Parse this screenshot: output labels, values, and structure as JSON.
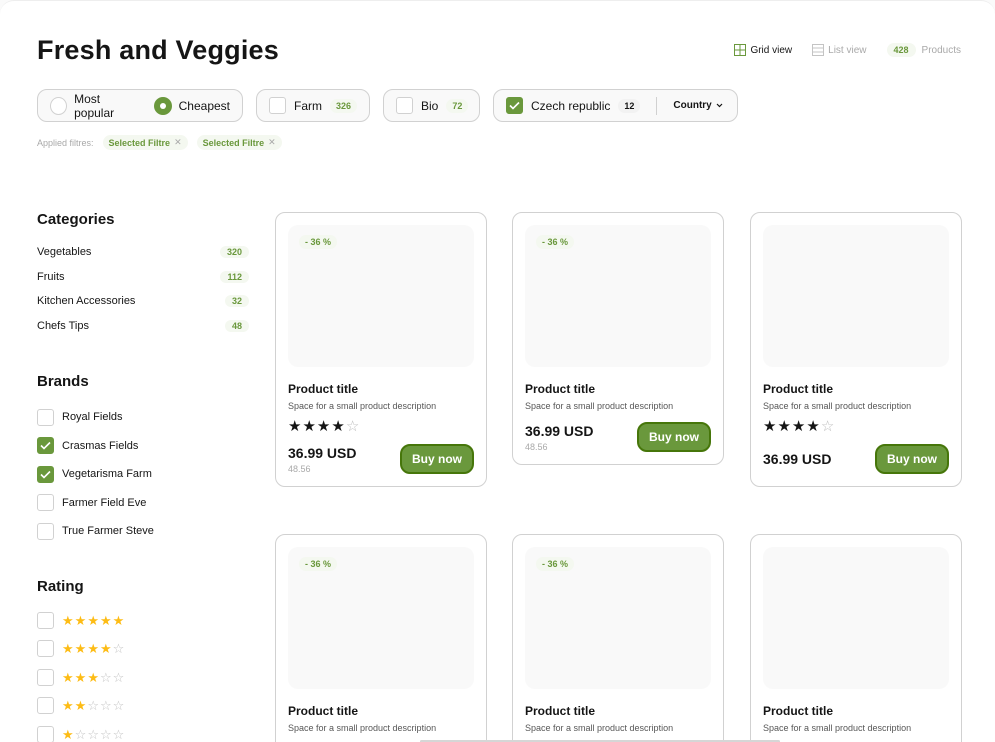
{
  "page": {
    "title": "Fresh and Veggies"
  },
  "viewbar": {
    "grid_label": "Grid view",
    "list_label": "List view",
    "product_count": "428",
    "products_label": "Products"
  },
  "filters": {
    "sort": {
      "most_popular": "Most popular",
      "cheapest": "Cheapest",
      "selected": "Cheapest"
    },
    "farm": {
      "label": "Farm",
      "count": "326",
      "checked": false
    },
    "bio": {
      "label": "Bio",
      "count": "72",
      "checked": false
    },
    "country": {
      "label": "Czech republic",
      "count": "12",
      "checked": true,
      "dropdown": "Country"
    },
    "applied_label": "Applied filtres:",
    "applied": [
      "Selected Filtre",
      "Selected Filtre"
    ]
  },
  "categories": {
    "heading": "Categories",
    "items": [
      {
        "label": "Vegetables",
        "count": "320"
      },
      {
        "label": "Fruits",
        "count": "112"
      },
      {
        "label": "Kitchen Accessories",
        "count": "32"
      },
      {
        "label": "Chefs Tips",
        "count": "48"
      }
    ]
  },
  "brands": {
    "heading": "Brands",
    "items": [
      {
        "label": "Royal Fields",
        "checked": false
      },
      {
        "label": "Crasmas Fields",
        "checked": true
      },
      {
        "label": "Vegetarisma Farm",
        "checked": true
      },
      {
        "label": "Farmer Field Eve",
        "checked": false
      },
      {
        "label": "True Farmer Steve",
        "checked": false
      }
    ]
  },
  "rating": {
    "heading": "Rating",
    "levels": [
      5,
      4,
      3,
      2,
      1
    ]
  },
  "products": [
    {
      "title": "Product title",
      "desc": "Space for a small product description",
      "discount": "- 36 %",
      "rating": 4,
      "price": "36.99 USD",
      "old_price": "48.56",
      "buy": "Buy now"
    },
    {
      "title": "Product title",
      "desc": "Space for a small product description",
      "discount": "- 36 %",
      "rating": 0,
      "price": "36.99 USD",
      "old_price": "48.56",
      "buy": "Buy now"
    },
    {
      "title": "Product title",
      "desc": "Space for a small product description",
      "discount": "",
      "rating": 4,
      "price": "36.99 USD",
      "old_price": "",
      "buy": "Buy now"
    },
    {
      "title": "Product title",
      "desc": "Space for a small product description",
      "discount": "- 36 %"
    },
    {
      "title": "Product title",
      "desc": "Space for a small product description",
      "discount": "- 36 %"
    },
    {
      "title": "Product title",
      "desc": "Space for a small product description",
      "discount": ""
    }
  ],
  "colors": {
    "accent": "#6a983c",
    "accent_dark": "#46760a",
    "star": "#fdbc15"
  }
}
